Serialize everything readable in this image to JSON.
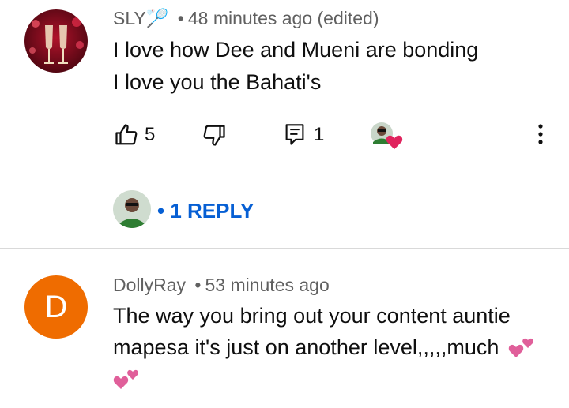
{
  "comment1": {
    "author": "SLY🏸",
    "separator": "•",
    "time": "48 minutes ago (edited)",
    "lines": [
      "I love how Dee and Mueni are bonding",
      "I love you the Bahati's"
    ],
    "likes": "5",
    "replies_count": "1",
    "reply_link": "• 1 REPLY",
    "avatar_icon": "champagne-glasses-icon",
    "creator_heart_icon": "heart-icon"
  },
  "comment2": {
    "author": "DollyRay",
    "separator": "•",
    "time": "53 minutes ago",
    "lines": [
      "The way you bring out your content auntie",
      "mapesa it's just on another level,,,,,much"
    ],
    "avatar_letter": "D",
    "avatar_color": "#ef6c00",
    "emoji_icon": "two-hearts-icon"
  },
  "colors": {
    "link": "#065fd4",
    "meta": "#606060",
    "text": "#0f0f0f",
    "heart": "#e0245e"
  }
}
